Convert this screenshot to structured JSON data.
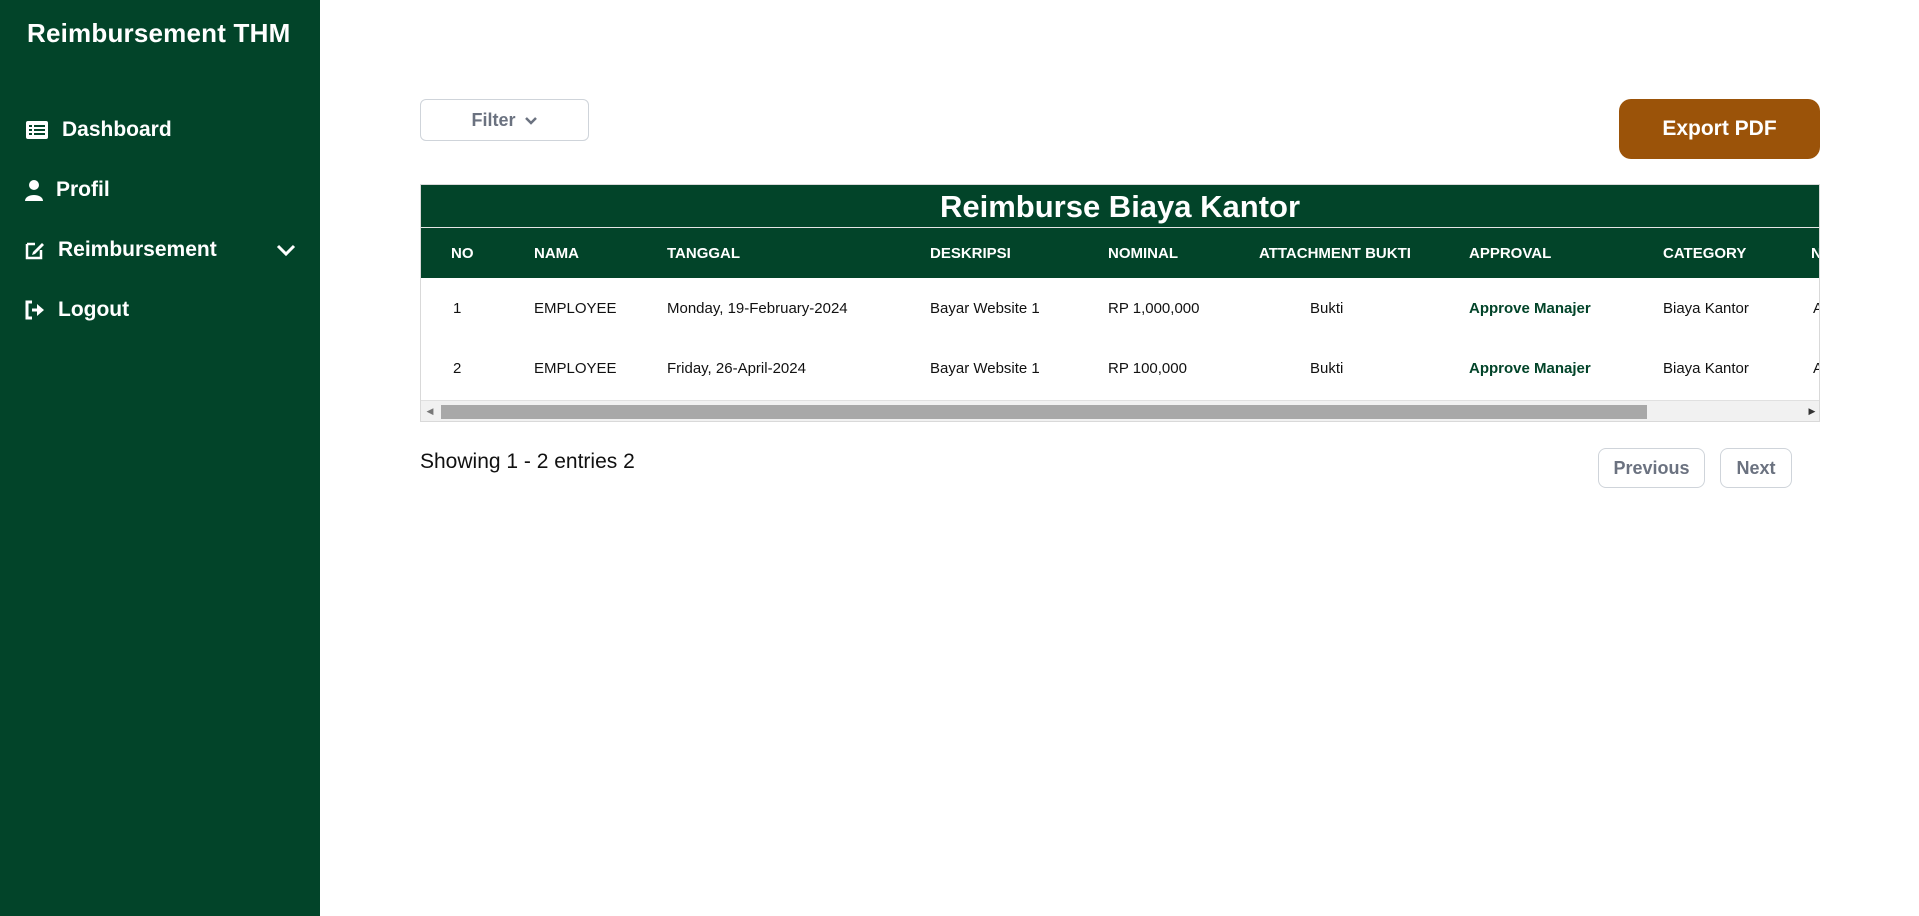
{
  "sidebar": {
    "brand": "Reimbursement THM",
    "items": [
      {
        "label": "Dashboard",
        "icon": "list-icon"
      },
      {
        "label": "Profil",
        "icon": "user-icon"
      },
      {
        "label": "Reimbursement",
        "icon": "edit-icon"
      },
      {
        "label": "Logout",
        "icon": "logout-icon"
      }
    ]
  },
  "toolbar": {
    "filter_label": "Filter",
    "export_label": "Export PDF"
  },
  "table": {
    "title": "Reimburse Biaya Kantor",
    "columns": [
      "NO",
      "NAMA",
      "TANGGAL",
      "DESKRIPSI",
      "NOMINAL",
      "ATTACHMENT BUKTI",
      "APPROVAL",
      "CATEGORY",
      "N"
    ],
    "rows": [
      {
        "no": "1",
        "nama": "EMPLOYEE",
        "tanggal": "Monday, 19-February-2024",
        "deskripsi": "Bayar Website 1",
        "nominal": "RP 1,000,000",
        "attachment": "Bukti",
        "approval": "Approve Manajer",
        "category": "Biaya Kantor",
        "extra": "A"
      },
      {
        "no": "2",
        "nama": "EMPLOYEE",
        "tanggal": "Friday, 26-April-2024",
        "deskripsi": "Bayar Website 1",
        "nominal": "RP 100,000",
        "attachment": "Bukti",
        "approval": "Approve Manajer",
        "category": "Biaya Kantor",
        "extra": "A"
      }
    ]
  },
  "footer": {
    "showing": "Showing 1 - 2 entries 2",
    "previous": "Previous",
    "next": "Next"
  },
  "colors": {
    "sidebar_bg": "#024429",
    "accent": "#9b5309"
  }
}
